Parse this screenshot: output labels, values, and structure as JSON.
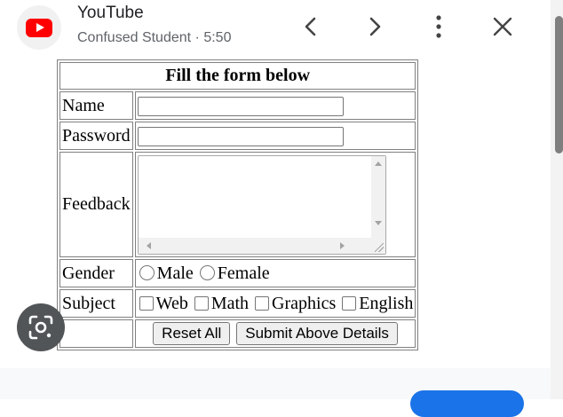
{
  "header": {
    "app_name": "YouTube",
    "channel": "Confused Student",
    "separator": "·",
    "time": "5:50",
    "icons": {
      "app": "youtube-logo-icon",
      "previous": "chevron-left-icon",
      "next": "chevron-right-icon",
      "more": "more-vert-icon",
      "close": "close-icon",
      "lens": "google-lens-icon"
    }
  },
  "form": {
    "title": "Fill the form below",
    "labels": {
      "name": "Name",
      "password": "Password",
      "feedback": "Feedback",
      "gender": "Gender",
      "subject": "Subject"
    },
    "values": {
      "name": "",
      "password": "",
      "feedback": ""
    },
    "gender_options": [
      "Male",
      "Female"
    ],
    "subject_options": [
      "Web",
      "Math",
      "Graphics",
      "English"
    ],
    "buttons": {
      "reset": "Reset All",
      "submit": "Submit Above Details"
    }
  },
  "colors": {
    "youtube_red": "#ff0000",
    "accent_blue": "#1a73e8",
    "text_primary": "#202124",
    "text_secondary": "#5f6368"
  }
}
